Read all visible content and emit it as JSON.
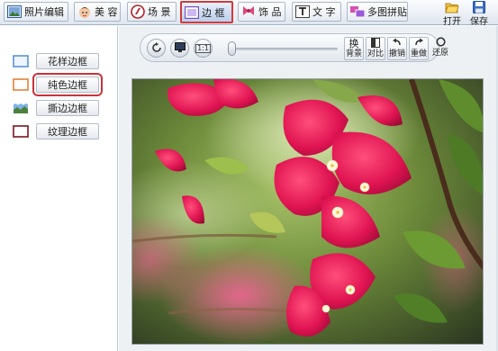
{
  "toolbar": {
    "tabs": [
      {
        "label": "照片编辑",
        "icon": "photo-edit-icon"
      },
      {
        "label": "美 容",
        "icon": "beauty-icon"
      },
      {
        "label": "场 景",
        "icon": "scene-icon"
      },
      {
        "label": "边 框",
        "icon": "frame-icon",
        "active": true
      },
      {
        "label": "饰 品",
        "icon": "accessory-icon"
      },
      {
        "label": "文 字",
        "icon": "text-icon"
      },
      {
        "label": "多图拼贴",
        "icon": "collage-icon"
      }
    ],
    "open_label": "打开",
    "save_label": "保存"
  },
  "sidebar": {
    "items": [
      {
        "label": "花样边框",
        "icon": "pattern-frame-icon"
      },
      {
        "label": "纯色边框",
        "icon": "solid-frame-icon",
        "selected": true
      },
      {
        "label": "撕边边框",
        "icon": "torn-frame-icon"
      },
      {
        "label": "纹理边框",
        "icon": "texture-frame-icon"
      }
    ]
  },
  "controls": {
    "rotate_icon": "rotate-icon",
    "fit_icon": "fit-screen-icon",
    "actual_size_label": "1:1",
    "zoom_value": 0,
    "swap_bg_label": "换\n背景",
    "compare_label": "对比",
    "undo_label": "撤销",
    "redo_label": "重做",
    "restore_label": "还原",
    "swap_bg_top": "换",
    "swap_bg_bottom": "背景"
  },
  "colors": {
    "accent_red": "#d23a3a",
    "flower_magenta": "#d6124a",
    "leaf_green": "#6f9a2f"
  }
}
